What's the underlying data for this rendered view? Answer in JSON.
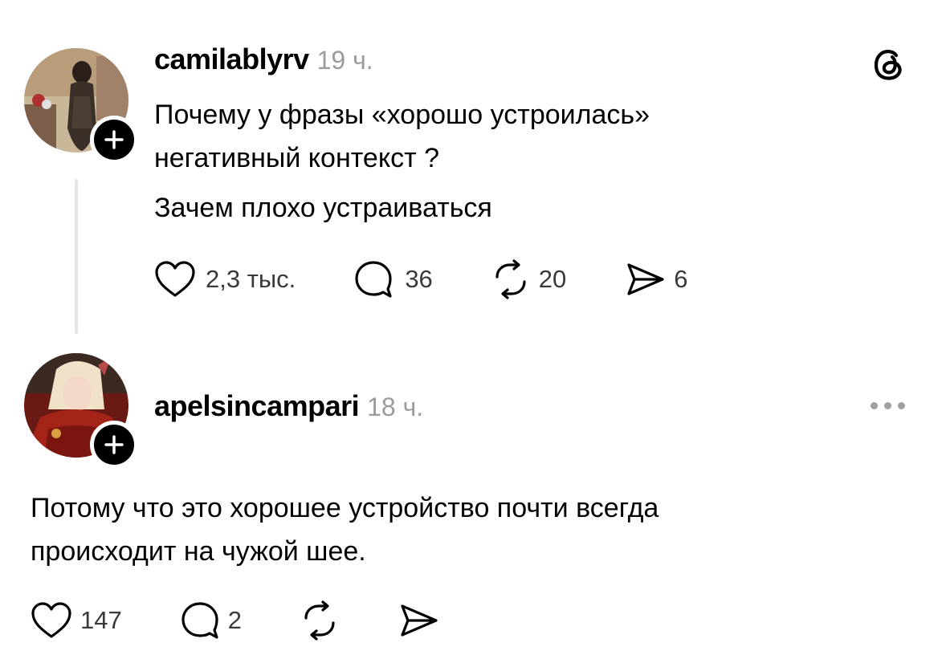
{
  "app": {
    "logo_icon": "threads-logo-icon"
  },
  "post": {
    "username": "camilablyrv",
    "time": "19 ч.",
    "text_line_1": "Почему у фразы «хорошо устроилась»",
    "text_line_2": "негативный контекст ?",
    "text_line_3": "Зачем плохо устраиваться",
    "likes": "2,3 тыс.",
    "comments": "36",
    "reposts": "20",
    "shares": "6"
  },
  "reply": {
    "username": "apelsincampari",
    "time": "18 ч.",
    "text_line_1": "Потому что это хорошее устройство почти всегда",
    "text_line_2": "происходит на чужой шее.",
    "likes": "147",
    "comments": "2"
  },
  "icons": {
    "like": "heart-icon",
    "comment": "comment-bubble-icon",
    "repost": "repost-icon",
    "share": "send-icon",
    "follow": "plus-icon",
    "more": "more-horizontal-icon"
  }
}
